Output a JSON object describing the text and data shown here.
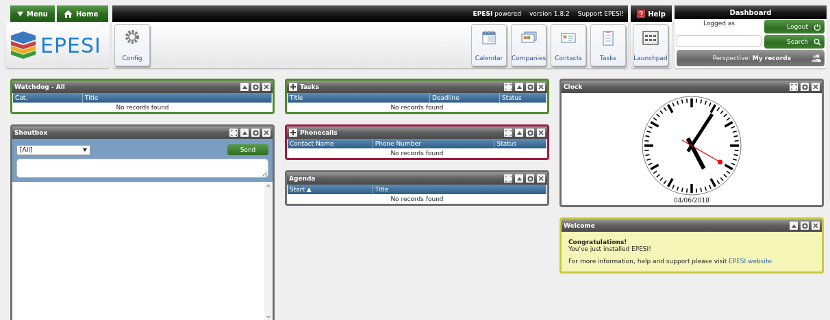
{
  "top_bar": {
    "menu": "Menu",
    "home": "Home",
    "powered": "**EPESI** powered",
    "version": "version 1.8.2",
    "support": "Support EPESI!",
    "help": "Help",
    "dashboard": "Dashboard"
  },
  "logo": "EPESI",
  "toolbar": [
    {
      "label": "Config"
    }
  ],
  "launchers": [
    {
      "label": "Calendar"
    },
    {
      "label": "Companies"
    },
    {
      "label": "Contacts"
    },
    {
      "label": "Tasks"
    }
  ],
  "launchpad": {
    "label": "Launchpad"
  },
  "user": {
    "logged_as": "Logged as",
    "logout": "Logout",
    "search": "Search",
    "perspective_label": "Perspective:",
    "perspective_value": "My records"
  },
  "columns": [
    [
      {
        "kind": "table",
        "title": "Watchdog - All",
        "color": "#4f8a2b",
        "addable": false,
        "maximizable": false,
        "minimizable": true,
        "headers": [
          "Cat.",
          "Title"
        ],
        "empty": "No records found"
      },
      {
        "kind": "shoutbox",
        "title": "Shoutbox",
        "color": "#6e6e6e",
        "addable": false,
        "maximizable": true,
        "minimizable": true,
        "recipient": "[All]",
        "send": "Send"
      }
    ],
    [
      {
        "kind": "table",
        "title": "Tasks",
        "color": "#4f8a2b",
        "addable": true,
        "maximizable": true,
        "minimizable": true,
        "headers": [
          "Title",
          "Deadline",
          "Status"
        ],
        "empty": "No records found"
      },
      {
        "kind": "table",
        "title": "Phonecalls",
        "color": "#a3173d",
        "addable": true,
        "maximizable": true,
        "minimizable": true,
        "headers": [
          "Contact Name",
          "Phone Number",
          "Status"
        ],
        "empty": "No records found"
      },
      {
        "kind": "table",
        "title": "Agenda",
        "color": "#6e6e6e",
        "addable": false,
        "maximizable": true,
        "minimizable": true,
        "headers": [
          "Start ▲",
          "Title"
        ],
        "empty": "No records found"
      }
    ],
    [
      {
        "kind": "clock",
        "title": "Clock",
        "color": "#6e6e6e",
        "addable": false,
        "maximizable": true,
        "minimizable": false,
        "date": "04/06/2018"
      },
      {
        "kind": "welcome",
        "title": "Welcome",
        "color": "#c9c93a",
        "addable": false,
        "maximizable": false,
        "minimizable": true,
        "heading": "Congratulations!",
        "line": "You've just installed EPESI!",
        "info": "For more information, help and support please visit",
        "link": "EPESI website"
      }
    ]
  ]
}
